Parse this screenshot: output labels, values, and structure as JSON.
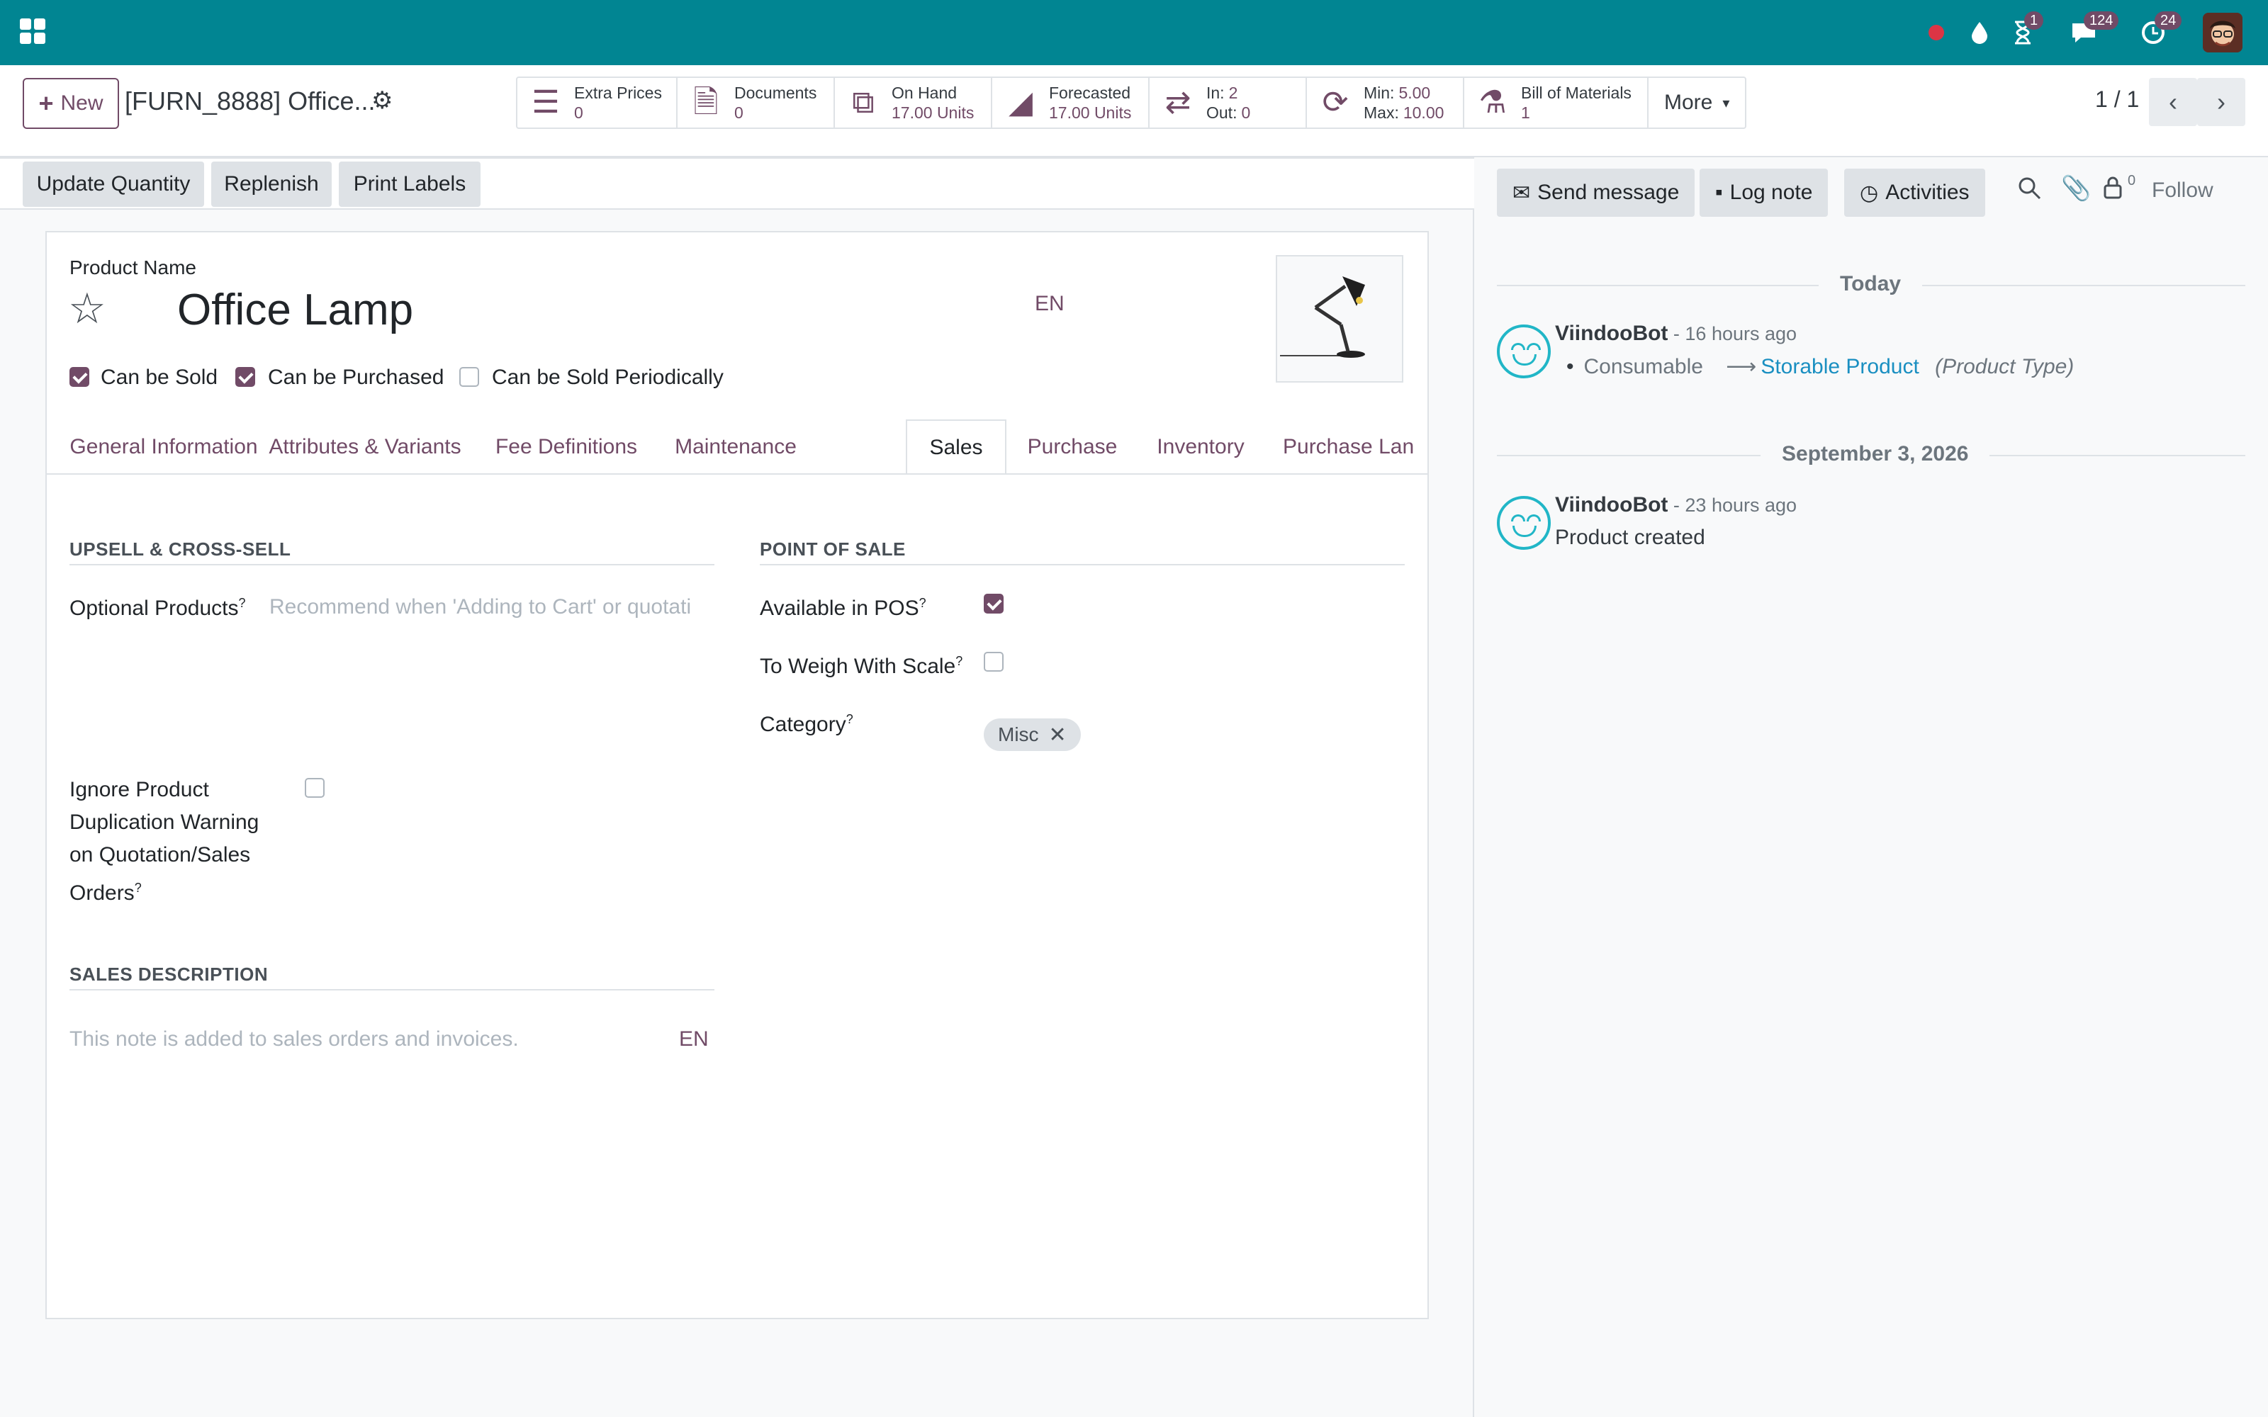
{
  "topbar": {
    "badges": {
      "activities": "1",
      "messages": "124",
      "updates": "24"
    },
    "colors": {
      "brand": "#018592",
      "accent": "#714b67"
    }
  },
  "control_panel": {
    "new_label": "New",
    "breadcrumb": "[FURN_8888] Office...",
    "smart_buttons": {
      "extra_prices": {
        "label": "Extra Prices",
        "value": "0"
      },
      "documents": {
        "label": "Documents",
        "value": "0"
      },
      "on_hand": {
        "label": "On Hand",
        "value": "17.00 Units"
      },
      "forecasted": {
        "label": "Forecasted",
        "value": "17.00 Units"
      },
      "in_out": {
        "in_label": "In:",
        "in_value": "2",
        "out_label": "Out:",
        "out_value": "0"
      },
      "min_max": {
        "min_label": "Min:",
        "min_value": "5.00",
        "max_label": "Max:",
        "max_value": "10.00"
      },
      "bom": {
        "label": "Bill of Materials",
        "value": "1"
      },
      "more": "More"
    },
    "pager": "1 / 1"
  },
  "header_buttons": {
    "update_quantity": "Update Quantity",
    "replenish": "Replenish",
    "print_labels": "Print Labels"
  },
  "product": {
    "name_label": "Product Name",
    "name": "Office Lamp",
    "lang": "EN",
    "checks": {
      "sold": "Can be Sold",
      "purchased": "Can be Purchased",
      "periodically": "Can be Sold Periodically"
    }
  },
  "tabs": [
    "General Information",
    "Attributes & Variants",
    "Fee Definitions",
    "Maintenance",
    "Sales",
    "Purchase",
    "Inventory",
    "Purchase Lan"
  ],
  "sales_tab": {
    "upsell_title": "UPSELL & CROSS-SELL",
    "optional_products_label": "Optional Products",
    "optional_products_placeholder": "Recommend when 'Adding to Cart' or quotati",
    "ignore_dup_label": [
      "Ignore Product",
      "Duplication Warning",
      "on Quotation/Sales",
      "Orders"
    ],
    "pos_title": "POINT OF SALE",
    "available_pos": "Available in POS",
    "weigh_scale": "To Weigh With Scale",
    "category": "Category",
    "category_tag": "Misc",
    "sales_desc_title": "SALES DESCRIPTION",
    "sales_desc_placeholder": "This note is added to sales orders and invoices.",
    "lang": "EN",
    "help": "?"
  },
  "chatter": {
    "send_message": "Send message",
    "log_note": "Log note",
    "activities": "Activities",
    "followers_count": "0",
    "follow": "Follow",
    "today": "Today",
    "msg1": {
      "author": "ViindooBot",
      "ago": " - 16 hours ago",
      "old": "Consumable",
      "new": "Storable Product",
      "field": "(Product Type)"
    },
    "date2": "September 3, 2026",
    "msg2": {
      "author": "ViindooBot",
      "ago": " - 23 hours ago",
      "body": "Product created"
    }
  }
}
